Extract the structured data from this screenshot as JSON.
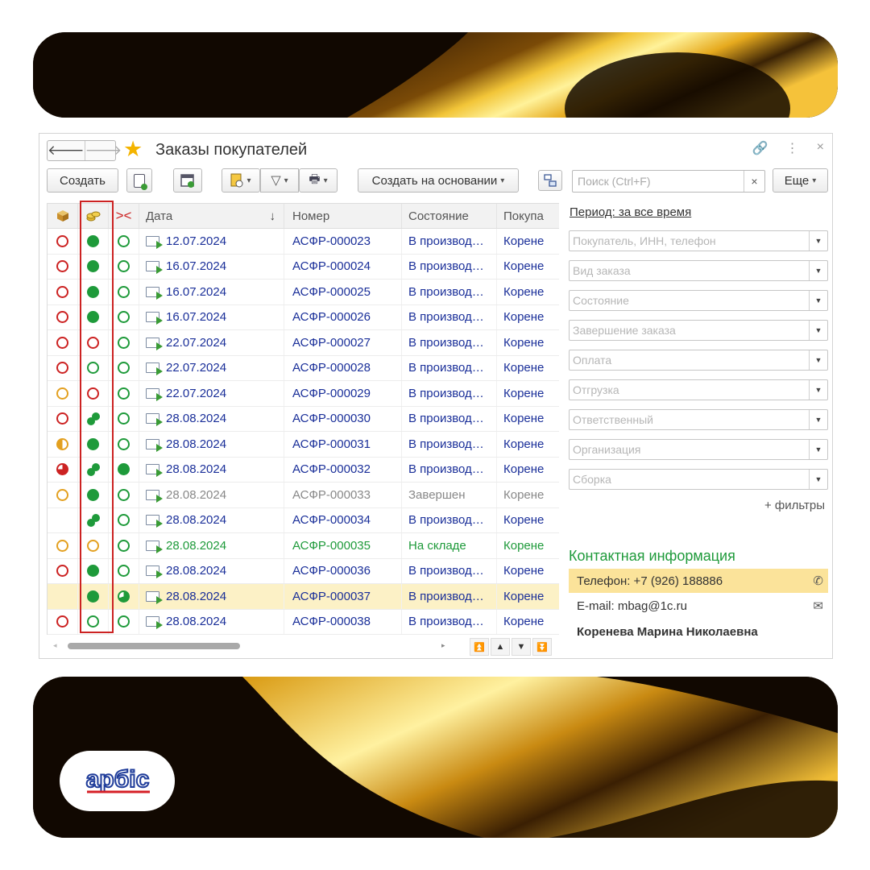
{
  "window": {
    "title": "Заказы покупателей",
    "nav_back": "🡐",
    "nav_forward": "🡒",
    "link_icon": "link-icon",
    "more_icon": "⋮",
    "close_icon": "×"
  },
  "toolbar": {
    "create_label": "Создать",
    "create_based_label": "Создать на основании",
    "search_placeholder": "Поиск (Ctrl+F)",
    "search_clear": "×",
    "more_label": "Еще"
  },
  "table": {
    "headers": {
      "date": "Дата",
      "sort_arrow": "↓",
      "number": "Номер",
      "state": "Состояние",
      "buyer": "Покупа"
    },
    "rows": [
      {
        "i1": "ring-red",
        "i2": "fill-green",
        "i3": "ring-green",
        "date": "12.07.2024",
        "number": "АСФР-000023",
        "state": "В производ…",
        "buyer": "Корене",
        "color": "blue"
      },
      {
        "i1": "ring-red",
        "i2": "fill-green",
        "i3": "ring-green",
        "date": "16.07.2024",
        "number": "АСФР-000024",
        "state": "В производ…",
        "buyer": "Корене",
        "color": "blue"
      },
      {
        "i1": "ring-red",
        "i2": "fill-green",
        "i3": "ring-green",
        "date": "16.07.2024",
        "number": "АСФР-000025",
        "state": "В производ…",
        "buyer": "Корене",
        "color": "blue"
      },
      {
        "i1": "ring-red",
        "i2": "fill-green",
        "i3": "ring-green",
        "date": "16.07.2024",
        "number": "АСФР-000026",
        "state": "В производ…",
        "buyer": "Корене",
        "color": "blue"
      },
      {
        "i1": "ring-red",
        "i2": "ring-red",
        "i3": "ring-green",
        "date": "22.07.2024",
        "number": "АСФР-000027",
        "state": "В производ…",
        "buyer": "Корене",
        "color": "blue"
      },
      {
        "i1": "ring-red",
        "i2": "ring-green",
        "i3": "ring-green",
        "date": "22.07.2024",
        "number": "АСФР-000028",
        "state": "В производ…",
        "buyer": "Корене",
        "color": "blue"
      },
      {
        "i1": "ring-orange",
        "i2": "ring-red",
        "i3": "ring-green",
        "date": "22.07.2024",
        "number": "АСФР-000029",
        "state": "В производ…",
        "buyer": "Корене",
        "color": "blue"
      },
      {
        "i1": "ring-red",
        "i2": "split",
        "i3": "ring-green",
        "date": "28.08.2024",
        "number": "АСФР-000030",
        "state": "В производ…",
        "buyer": "Корене",
        "color": "blue"
      },
      {
        "i1": "half-orange",
        "i2": "fill-green",
        "i3": "ring-green",
        "date": "28.08.2024",
        "number": "АСФР-000031",
        "state": "В производ…",
        "buyer": "Корене",
        "color": "blue"
      },
      {
        "i1": "half-red",
        "i2": "split",
        "i3": "fill-green",
        "date": "28.08.2024",
        "number": "АСФР-000032",
        "state": "В производ…",
        "buyer": "Корене",
        "color": "blue"
      },
      {
        "i1": "ring-orange",
        "i2": "fill-green",
        "i3": "ring-green",
        "date": "28.08.2024",
        "number": "АСФР-000033",
        "state": "Завершен",
        "buyer": "Корене",
        "color": "gray"
      },
      {
        "i1": "",
        "i2": "split",
        "i3": "ring-green",
        "date": "28.08.2024",
        "number": "АСФР-000034",
        "state": "В производ…",
        "buyer": "Корене",
        "color": "blue"
      },
      {
        "i1": "ring-orange",
        "i2": "ring-orange",
        "i3": "ring-green",
        "date": "28.08.2024",
        "number": "АСФР-000035",
        "state": "На складе",
        "buyer": "Корене",
        "color": "green"
      },
      {
        "i1": "ring-red",
        "i2": "fill-green",
        "i3": "ring-green",
        "date": "28.08.2024",
        "number": "АСФР-000036",
        "state": "В производ…",
        "buyer": "Корене",
        "color": "blue"
      },
      {
        "i1": "",
        "i2": "fill-green",
        "i3": "half-green",
        "date": "28.08.2024",
        "number": "АСФР-000037",
        "state": "В производ…",
        "buyer": "Корене",
        "color": "blue",
        "selected": true
      },
      {
        "i1": "ring-red",
        "i2": "ring-green",
        "i3": "ring-green",
        "date": "28.08.2024",
        "number": "АСФР-000038",
        "state": "В производ…",
        "buyer": "Корене",
        "color": "blue"
      }
    ]
  },
  "filters": {
    "period_label": "Период: за все время",
    "items": [
      "Покупатель, ИНН, телефон",
      "Вид заказа",
      "Состояние",
      "Завершение заказа",
      "Оплата",
      "Отгрузка",
      "Ответственный",
      "Организация",
      "Сборка"
    ],
    "more_filters": "+ фильтры"
  },
  "contact": {
    "title": "Контактная информация",
    "phone": "Телефон: +7 (926) 188886",
    "email": "E-mail: mbag@1c.ru",
    "name": "Коренева Марина Николаевна",
    "phone_icon": "✆",
    "email_icon": "✉"
  },
  "logo": {
    "text": "арбіс"
  }
}
